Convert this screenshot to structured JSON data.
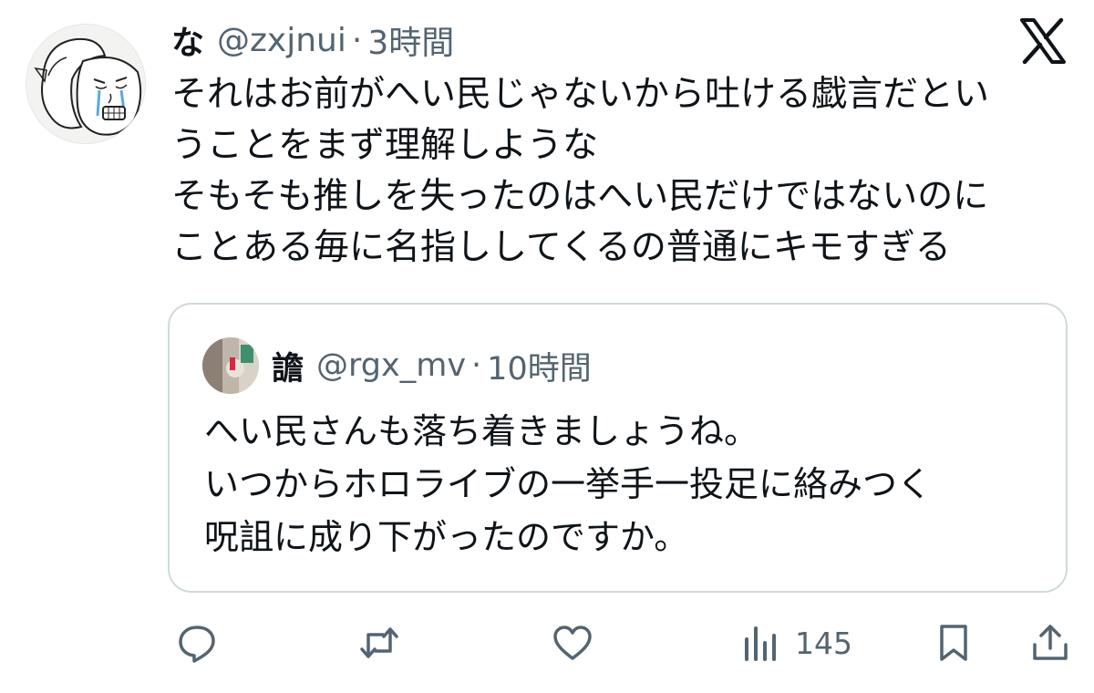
{
  "tweet": {
    "display_name": "な",
    "handle": "@zxjnui",
    "separator": "·",
    "time": "3時間",
    "body_lines": [
      "それはお前がへい民じゃないから吐ける戯言だとい",
      "うことをまず理解しような",
      "そもそも推しを失ったのはへい民だけではないのに",
      "ことある毎に名指ししてくるの普通にキモすぎる"
    ]
  },
  "quoted_tweet": {
    "display_name": "譫",
    "handle": "@rgx_mv",
    "separator": "·",
    "time": "10時間",
    "body_lines": [
      "へい民さんも落ち着きましょうね。",
      "いつからホロライブの一挙手一投足に絡みつく",
      "呪詛に成り下がったのですか。"
    ]
  },
  "actions": {
    "reply_icon": "speech-bubble-icon",
    "retweet_icon": "retweet-arrows-icon",
    "like_icon": "heart-icon",
    "views_icon": "bar-chart-icon",
    "views_count": "145",
    "bookmark_icon": "bookmark-icon",
    "share_icon": "share-upload-icon"
  },
  "brand": {
    "logo_icon": "x-logo-icon",
    "text_color": "#0f1419",
    "secondary_color": "#536471",
    "border_color": "#cfd9de"
  }
}
